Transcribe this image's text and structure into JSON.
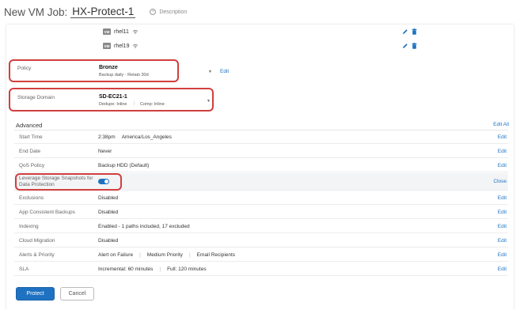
{
  "header": {
    "title_prefix": "New VM Job:",
    "job_name": "HX-Protect-1",
    "description_label": "Description",
    "description_icon": "plus-circle-icon"
  },
  "vms": [
    {
      "badge": "VM",
      "name": "rhel11",
      "status_icon": "network-icon"
    },
    {
      "badge": "VM",
      "name": "rhel19",
      "status_icon": "network-icon"
    }
  ],
  "vm_action_icons": [
    "edit-pencil-icon",
    "delete-trash-icon"
  ],
  "policy": {
    "label": "Policy",
    "value": "Bronze",
    "subtext": "Backup daily · Retain 30d",
    "edit_label": "Edit"
  },
  "storage_domain": {
    "label": "Storage Domain",
    "value": "SD-EC21-1",
    "dedupe": "Dedupe: Inline",
    "comp": "Comp: Inline"
  },
  "advanced": {
    "title": "Advanced",
    "edit_all": "Edit All",
    "rows": [
      {
        "label": "Start Time",
        "values": [
          "2:38pm",
          "America/Los_Angeles"
        ],
        "action": "Edit"
      },
      {
        "label": "End Date",
        "values": [
          "Never"
        ],
        "action": "Edit"
      },
      {
        "label": "QoS Policy",
        "values": [
          "Backup HDD (Default)"
        ],
        "action": "Edit"
      },
      {
        "label": "Leverage Storage Snapshots for Data Protection",
        "toggle": true,
        "action": "Close"
      },
      {
        "label": "Exclusions",
        "values": [
          "Disabled"
        ],
        "action": "Edit"
      },
      {
        "label": "App Consistent Backups",
        "values": [
          "Disabled"
        ],
        "action": "Edit"
      },
      {
        "label": "Indexing",
        "values": [
          "Enabled - 1 paths included, 17 excluded"
        ],
        "action": "Edit"
      },
      {
        "label": "Cloud Migration",
        "values": [
          "Disabled"
        ],
        "action": "Edit"
      },
      {
        "label": "Alerts & Priority",
        "values": [
          "Alert on Failure",
          "Medium Priority",
          "Email Recipients"
        ],
        "action": "Edit"
      },
      {
        "label": "SLA",
        "values": [
          "Incremental: 60 minutes",
          "Full: 120 minutes"
        ],
        "action": "Edit"
      }
    ]
  },
  "buttons": {
    "protect": "Protect",
    "cancel": "Cancel"
  },
  "colors": {
    "accent": "#1f72c2",
    "highlight": "#d13f3f"
  }
}
